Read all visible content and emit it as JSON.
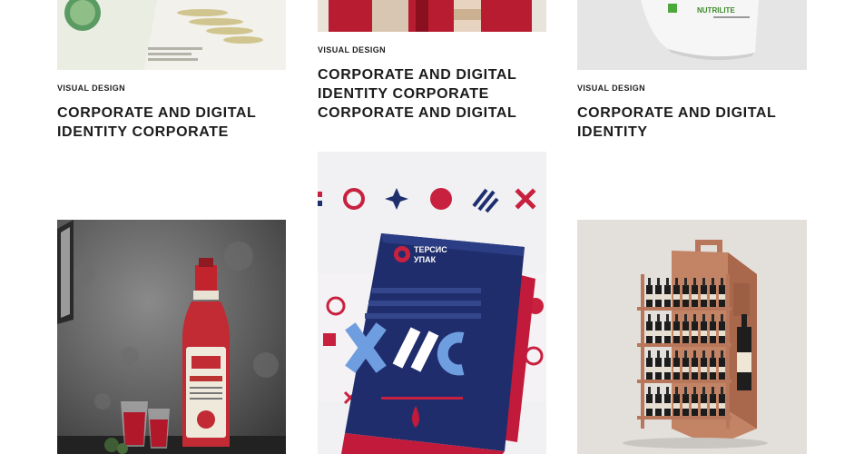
{
  "portfolio": {
    "items": [
      {
        "category": "VISUAL DESIGN",
        "title_line1": "CORPORATE AND DIGITAL",
        "title_line2": "IDENTITY CORPORATE",
        "title_line3": ""
      },
      {
        "category": "VISUAL DESIGN",
        "title_line1": "CORPORATE AND DIGITAL",
        "title_line2": "IDENTITY CORPORATE",
        "title_line3": "CORPORATE AND DIGITAL"
      },
      {
        "category": "VISUAL DESIGN",
        "title_line1": "CORPORATE AND DIGITAL",
        "title_line2": "IDENTITY",
        "title_line3": ""
      }
    ],
    "image_texts": {
      "nutrilite_brand": "NUTRILITE",
      "folder_brand_line1": "ТЕРСИС",
      "folder_brand_line2": "УПАК"
    }
  },
  "colors": {
    "brand_red": "#c8213f",
    "brand_navy": "#1e2f6e",
    "copper": "#b8765a"
  }
}
